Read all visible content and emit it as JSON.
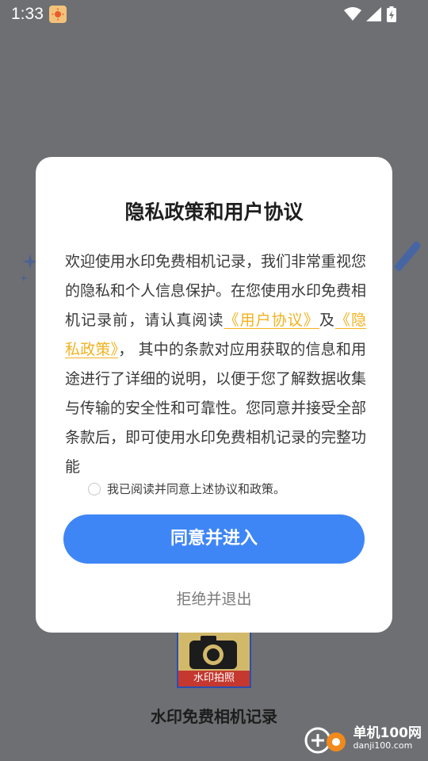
{
  "status_bar": {
    "time": "1:33"
  },
  "background": {
    "app_icon_label": "水印拍照",
    "app_name": "水印免费相机记录"
  },
  "watermark": {
    "title": "单机100网",
    "url": "danji100.com"
  },
  "dialog": {
    "title": "隐私政策和用户协议",
    "body_intro": "欢迎使用水印免费相机记录，我们非常重视您的隐私和个人信息保护。在您使用水印免费相机记录前，请认真阅读",
    "user_agreement_link": "《用户协议》",
    "conjunction": "及",
    "privacy_policy_link": "《隐私政策》",
    "body_rest": "， 其中的条款对应用获取的信息和用途进行了详细的说明，以便于您了解数据收集与传输的安全性和可靠性。您同意并接受全部条款后，即可使用水印免费相机记录的完整功能",
    "consent_label": "我已阅读并同意上述协议和政策。",
    "agree_button": "同意并进入",
    "reject_button": "拒绝并退出"
  },
  "colors": {
    "accent": "#3e86f6",
    "link": "#f2b21e",
    "overlay": "#6e6f73"
  },
  "icons": [
    "sun-app-icon",
    "wifi-icon",
    "signal-icon",
    "battery-charging-icon",
    "camera-icon",
    "site-logo-icon"
  ]
}
